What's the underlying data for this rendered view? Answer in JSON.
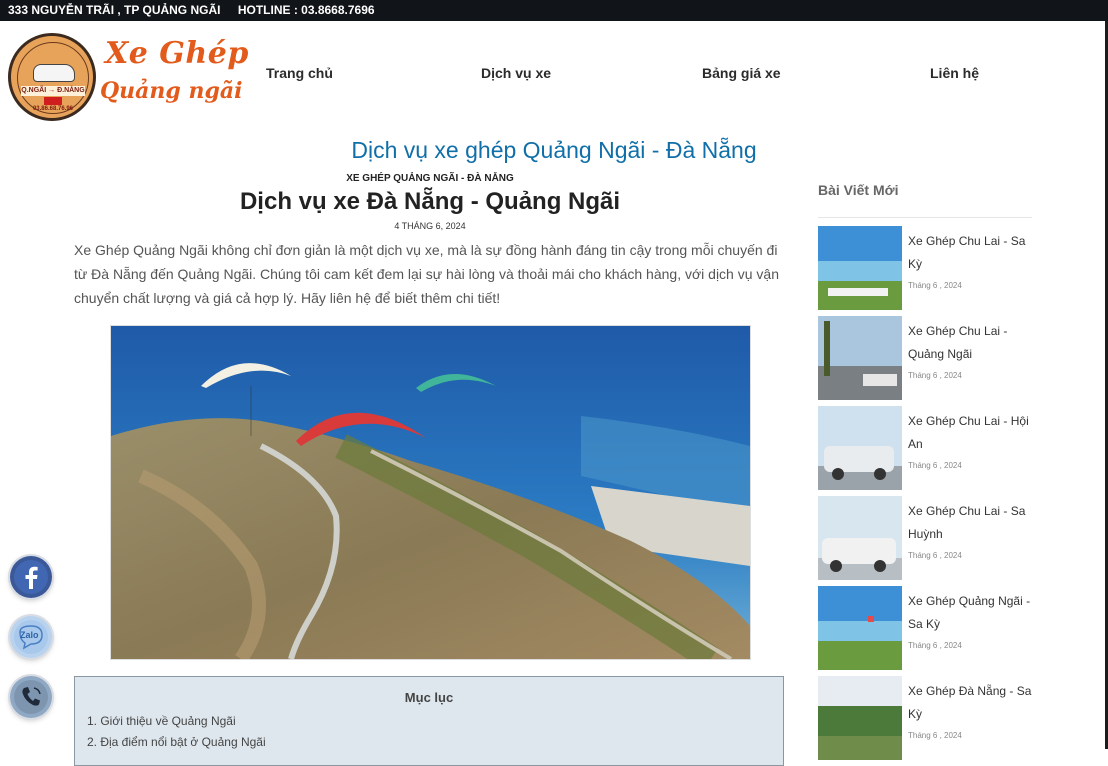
{
  "topbar": {
    "address": "333 NGUYỄN TRÃI , TP QUẢNG NGÃI",
    "hotline": "HOTLINE : 03.8668.7696"
  },
  "logo": {
    "line1": "Xe Ghép",
    "line2": "Quảng ngãi",
    "badge_route": "Q.NGÃI → Đ.NẴNG",
    "badge_phone": "03.86.68.76.96"
  },
  "nav": {
    "items": [
      {
        "label": "Trang chủ"
      },
      {
        "label": "Dịch vụ xe"
      },
      {
        "label": "Bảng giá xe"
      },
      {
        "label": "Liên hệ"
      }
    ]
  },
  "page": {
    "title": "Dịch vụ xe ghép Quảng Ngãi - Đà Nẵng"
  },
  "article": {
    "category": "XE GHÉP QUẢNG NGÃI - ĐÀ NẴNG",
    "title": "Dịch vụ xe Đà Nẵng - Quảng Ngãi",
    "date": "4 THÁNG 6, 2024",
    "intro": "Xe Ghép Quảng Ngãi không chỉ đơn giản là một dịch vụ xe, mà là sự đồng hành đáng tin cậy trong mỗi chuyến đi từ Đà Nẵng đến Quảng Ngãi. Chúng tôi cam kết đem lại sự hài lòng và thoải mái cho khách hàng, với dịch vụ vận chuyển chất lượng và giá cả hợp lý. Hãy liên hệ để biết thêm chi tiết!"
  },
  "toc": {
    "title": "Mục lục",
    "items": [
      "1. Giới thiệu về Quảng Ngãi",
      "2. Địa điểm nổi bật ở Quảng Ngãi"
    ]
  },
  "sidebar": {
    "title": "Bài Viết Mới",
    "posts": [
      {
        "title": "Xe Ghép Chu Lai - Sa Kỳ",
        "date": "Tháng 6 , 2024"
      },
      {
        "title": "Xe Ghép Chu Lai - Quảng Ngãi",
        "date": "Tháng 6 , 2024"
      },
      {
        "title": "Xe Ghép Chu Lai - Hội An",
        "date": "Tháng 6 , 2024"
      },
      {
        "title": "Xe Ghép Chu Lai - Sa Huỳnh",
        "date": "Tháng 6 , 2024"
      },
      {
        "title": "Xe Ghép Quảng Ngãi - Sa Kỳ",
        "date": "Tháng 6 , 2024"
      },
      {
        "title": "Xe Ghép Đà Nẵng - Sa Kỳ",
        "date": "Tháng 6 , 2024"
      }
    ]
  },
  "social": {
    "zalo_label": "Zalo"
  },
  "colors": {
    "topbar_bg": "#111418",
    "title_blue": "#106fa9",
    "logo_orange": "#e25b1c",
    "toc_bg": "#dfe7ee"
  }
}
